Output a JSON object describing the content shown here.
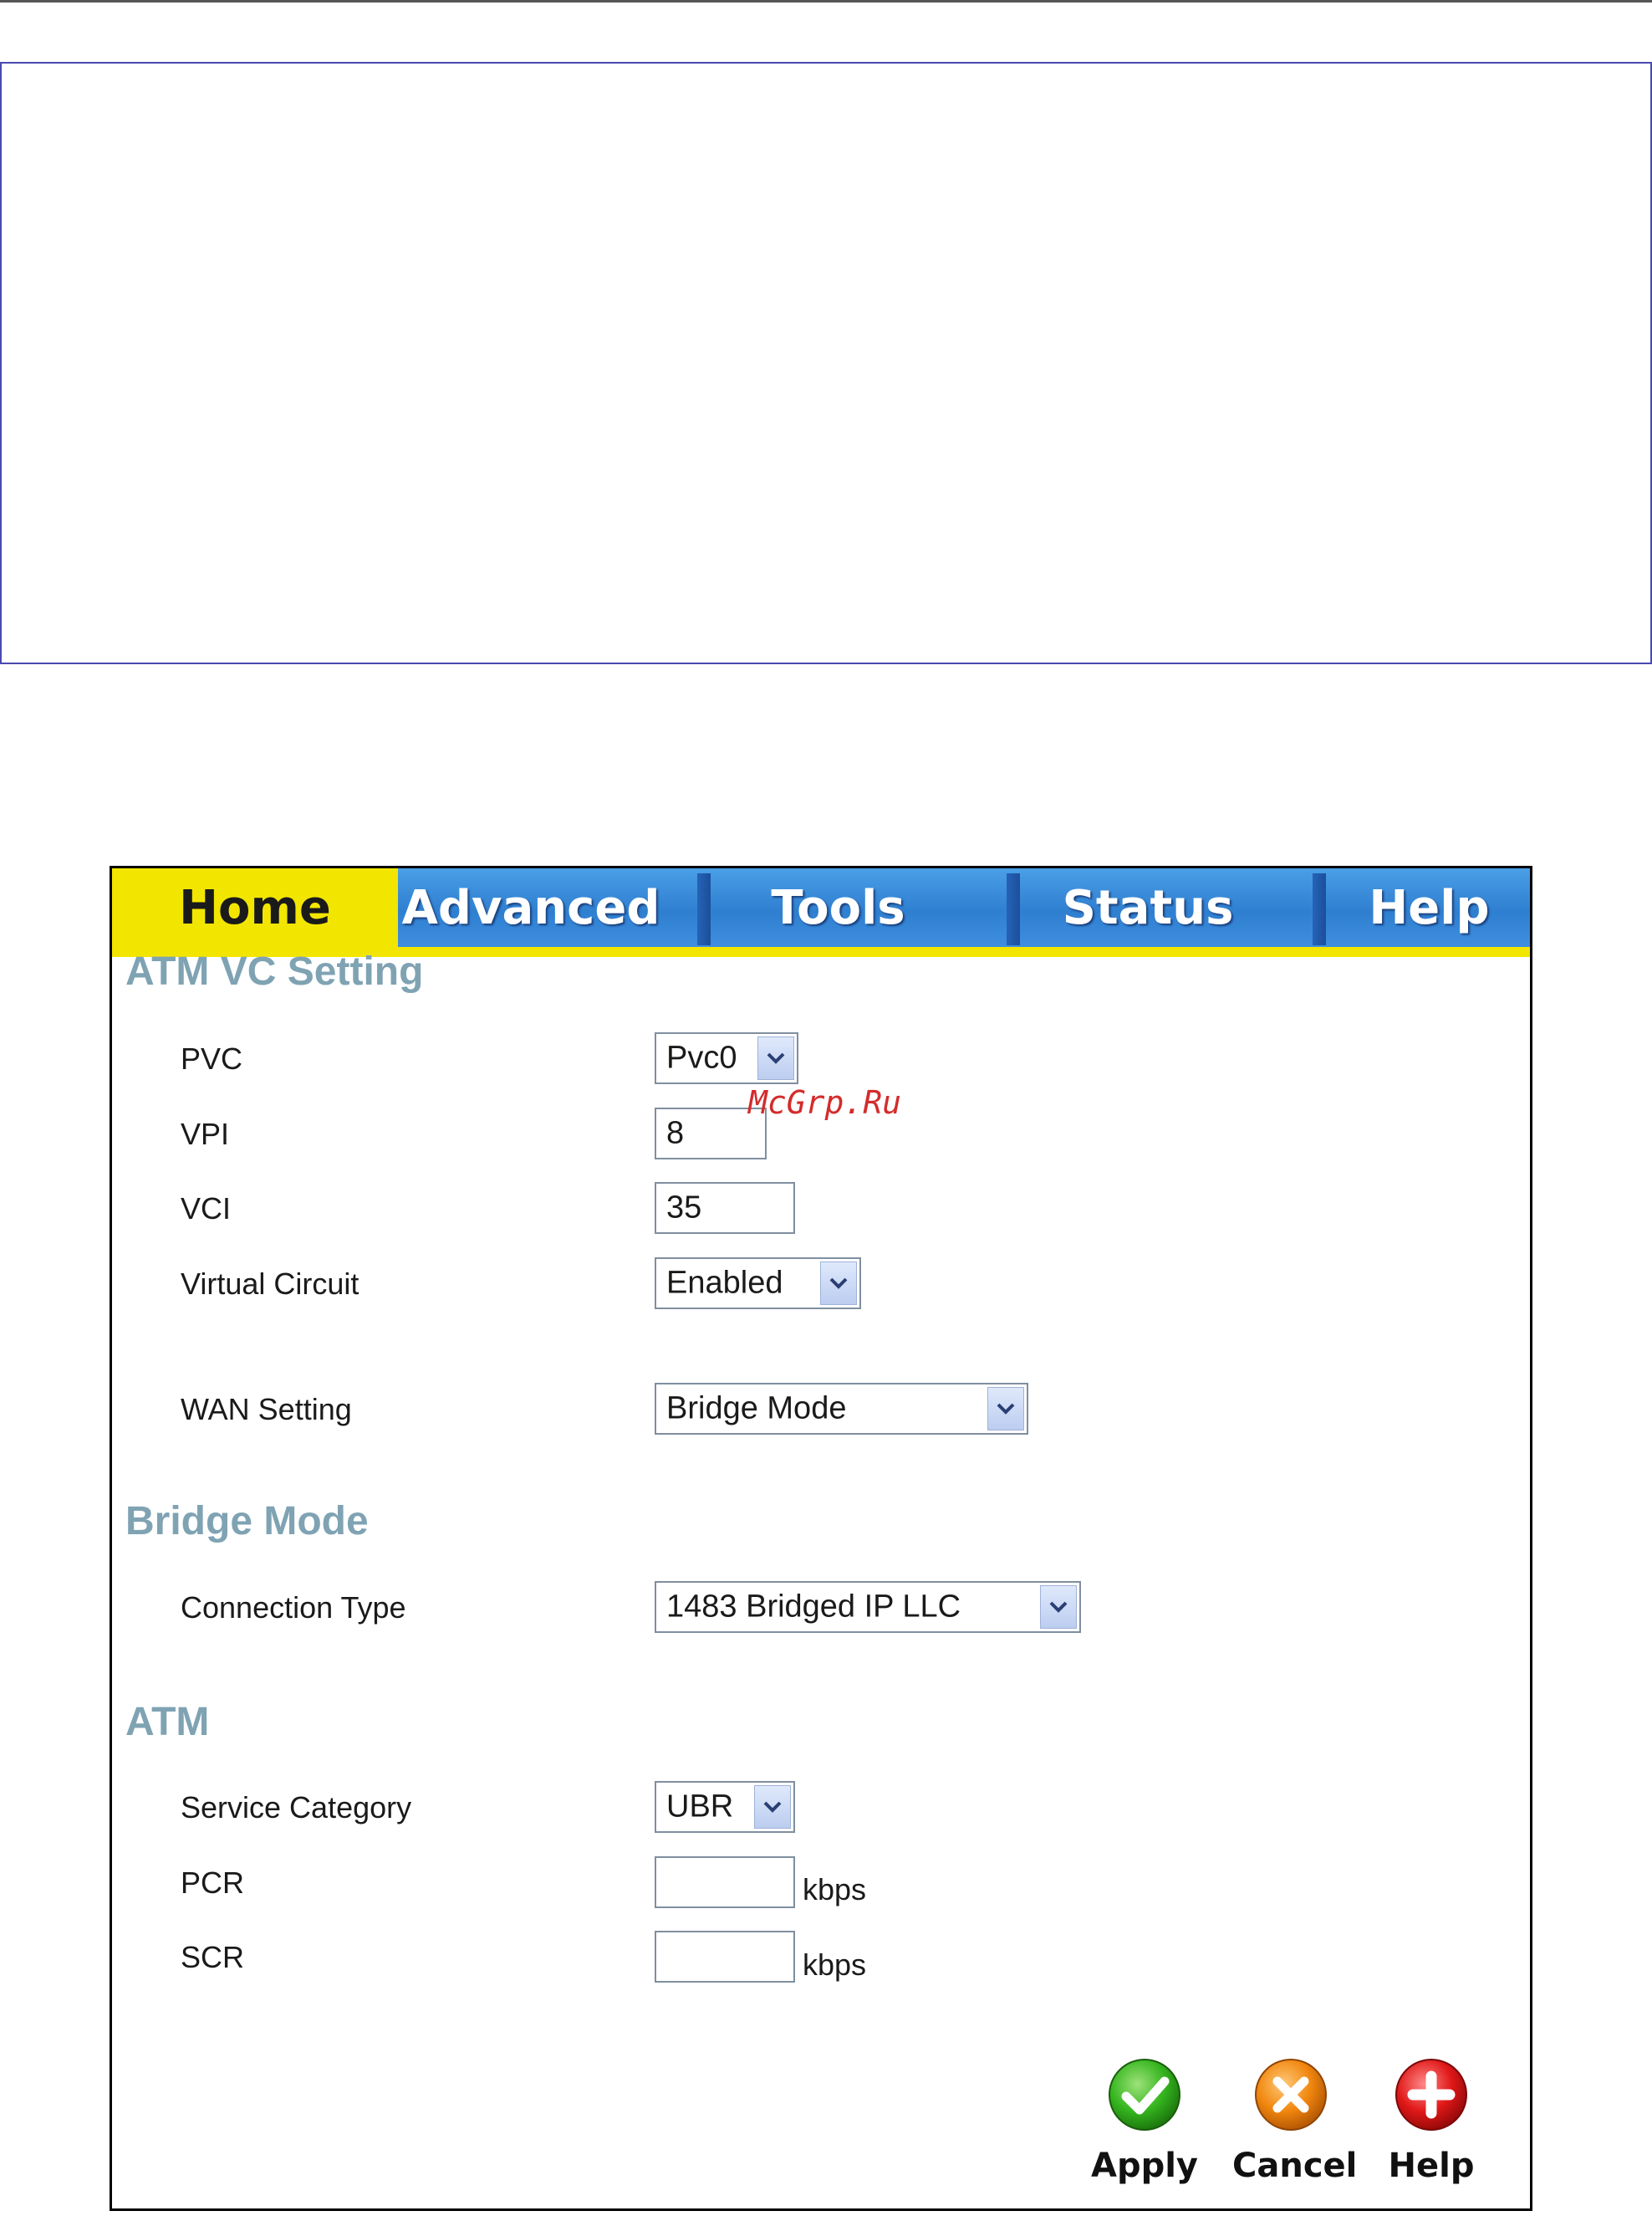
{
  "tabs": [
    {
      "label": "Home",
      "active": true
    },
    {
      "label": "Advanced",
      "active": false
    },
    {
      "label": "Tools",
      "active": false
    },
    {
      "label": "Status",
      "active": false
    },
    {
      "label": "Help",
      "active": false
    }
  ],
  "atm_vc": {
    "title": "ATM VC Setting",
    "pvc": {
      "label": "PVC",
      "value": "Pvc0"
    },
    "vpi": {
      "label": "VPI",
      "value": "8"
    },
    "vci": {
      "label": "VCI",
      "value": "35"
    },
    "virtual_circuit": {
      "label": "Virtual Circuit",
      "value": "Enabled"
    },
    "wan_setting": {
      "label": "WAN Setting",
      "value": "Bridge Mode"
    }
  },
  "bridge_mode": {
    "title": "Bridge Mode",
    "connection_type": {
      "label": "Connection Type",
      "value": "1483 Bridged IP LLC"
    }
  },
  "atm": {
    "title": "ATM",
    "service_category": {
      "label": "Service Category",
      "value": "UBR"
    },
    "pcr": {
      "label": "PCR",
      "value": "",
      "unit": "kbps"
    },
    "scr": {
      "label": "SCR",
      "value": "",
      "unit": "kbps"
    }
  },
  "actions": {
    "apply": "Apply",
    "cancel": "Cancel",
    "help": "Help"
  },
  "watermark": "McGrp.Ru",
  "colors": {
    "tab_blue": "#3f8ee0",
    "tab_active_yellow": "#f2e600",
    "section_title": "#7fa3b3",
    "apply_green": "#35b51f",
    "cancel_orange": "#f0860e",
    "help_red": "#e01818"
  },
  "icons": {
    "apply": "check-icon",
    "cancel": "x-icon",
    "help": "plus-icon",
    "select": "chevron-down-icon"
  }
}
